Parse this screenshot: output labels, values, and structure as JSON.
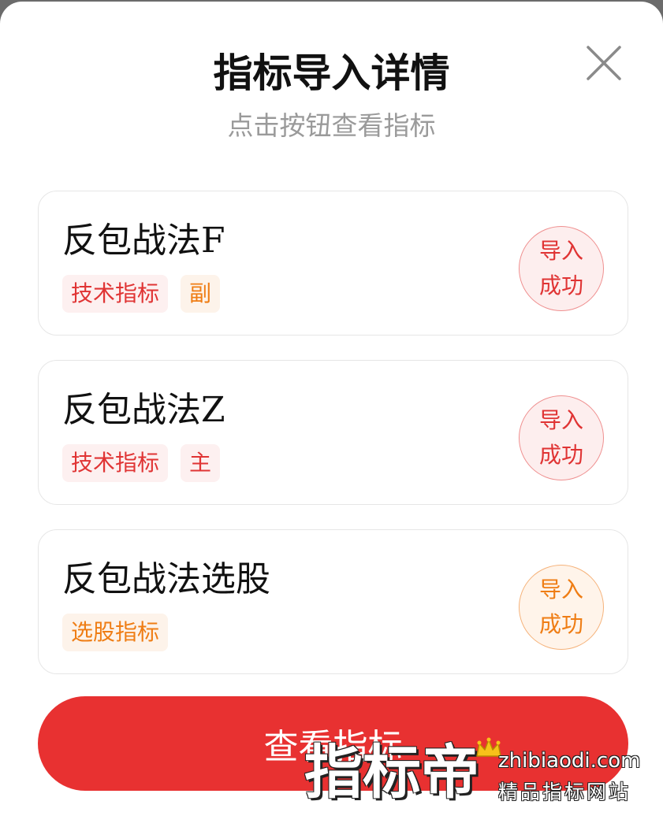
{
  "dialog": {
    "title": "指标导入详情",
    "subtitle": "点击按钮查看指标",
    "close_icon": "close-icon"
  },
  "items": [
    {
      "name": "反包战法F",
      "tags": [
        {
          "label": "技术指标",
          "color": "red"
        },
        {
          "label": "副",
          "color": "orange"
        }
      ],
      "status_line1": "导入",
      "status_line2": "成功",
      "status_color": "red"
    },
    {
      "name": "反包战法Z",
      "tags": [
        {
          "label": "技术指标",
          "color": "red"
        },
        {
          "label": "主",
          "color": "red"
        }
      ],
      "status_line1": "导入",
      "status_line2": "成功",
      "status_color": "red"
    },
    {
      "name": "反包战法选股",
      "tags": [
        {
          "label": "选股指标",
          "color": "orange"
        }
      ],
      "status_line1": "导入",
      "status_line2": "成功",
      "status_color": "orange"
    }
  ],
  "footer": {
    "view_button_label": "查看指标"
  },
  "watermark": {
    "big_text": "指标帝",
    "domain": "zhibiaodi.com",
    "slogan": "精品指标网站"
  },
  "colors": {
    "accent": "#e83131",
    "tag_red": "#e03434",
    "tag_orange": "#ef7d14"
  }
}
